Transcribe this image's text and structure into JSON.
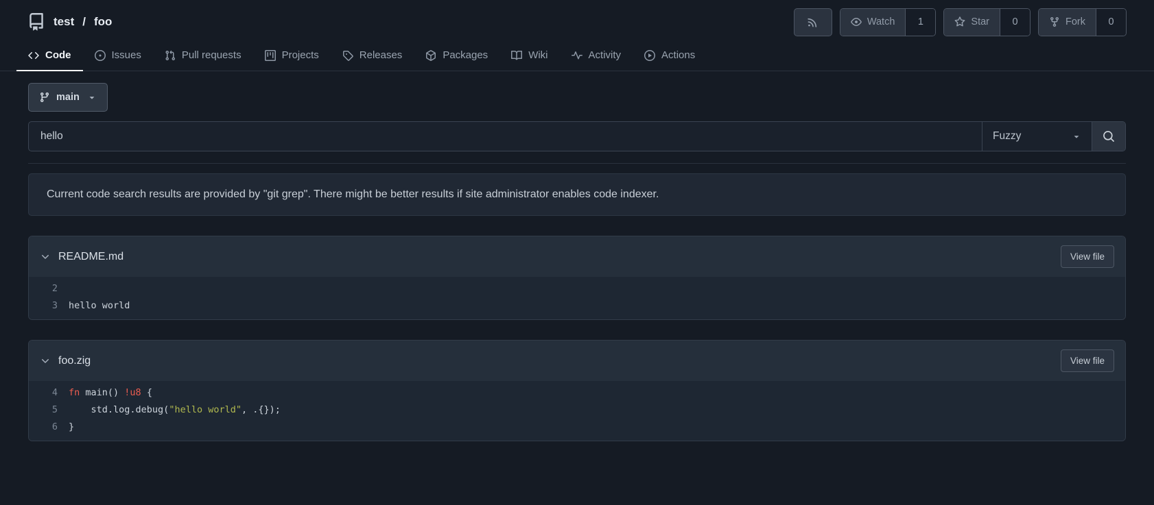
{
  "repo": {
    "owner": "test",
    "separator": "/",
    "name": "foo"
  },
  "header_actions": {
    "rss": {
      "icon": "rss-icon"
    },
    "watch": {
      "label": "Watch",
      "count": "1",
      "icon": "eye-icon"
    },
    "star": {
      "label": "Star",
      "count": "0",
      "icon": "star-icon"
    },
    "fork": {
      "label": "Fork",
      "count": "0",
      "icon": "fork-icon"
    }
  },
  "tabs": [
    {
      "label": "Code",
      "icon": "code-icon",
      "active": true
    },
    {
      "label": "Issues",
      "icon": "issue-opened-icon",
      "active": false
    },
    {
      "label": "Pull requests",
      "icon": "git-pull-request-icon",
      "active": false
    },
    {
      "label": "Projects",
      "icon": "project-icon",
      "active": false
    },
    {
      "label": "Releases",
      "icon": "tag-icon",
      "active": false
    },
    {
      "label": "Packages",
      "icon": "package-icon",
      "active": false
    },
    {
      "label": "Wiki",
      "icon": "book-icon",
      "active": false
    },
    {
      "label": "Activity",
      "icon": "pulse-icon",
      "active": false
    },
    {
      "label": "Actions",
      "icon": "play-circle-icon",
      "active": false
    }
  ],
  "branch_selector": {
    "label": "main",
    "icon": "git-branch-icon",
    "caret": "caret-down-icon"
  },
  "search": {
    "value": "hello",
    "mode": "Fuzzy",
    "button_icon": "search-icon"
  },
  "notice": "Current code search results are provided by \"git grep\". There might be better results if site administrator enables code indexer.",
  "results": [
    {
      "filename": "README.md",
      "view_button": "View file",
      "lines": [
        {
          "num": "2",
          "segments": []
        },
        {
          "num": "3",
          "segments": [
            {
              "t": "hello world",
              "c": "plain"
            }
          ]
        }
      ]
    },
    {
      "filename": "foo.zig",
      "view_button": "View file",
      "lines": [
        {
          "num": "4",
          "segments": [
            {
              "t": "fn",
              "c": "keyword"
            },
            {
              "t": " main() ",
              "c": "plain"
            },
            {
              "t": "!u8",
              "c": "keyword"
            },
            {
              "t": " {",
              "c": "plain"
            }
          ]
        },
        {
          "num": "5",
          "segments": [
            {
              "t": "    std.log.debug(",
              "c": "plain"
            },
            {
              "t": "\"hello world\"",
              "c": "string"
            },
            {
              "t": ", .{});",
              "c": "plain"
            }
          ]
        },
        {
          "num": "6",
          "segments": [
            {
              "t": "}",
              "c": "plain"
            }
          ]
        }
      ]
    }
  ],
  "colors": {
    "background": "#151b24",
    "card_header": "#252f3b",
    "code_background": "#1e2733",
    "keyword": "#ee5d50",
    "string": "#b1b94f",
    "active_tab_underline": "#ffffff"
  }
}
